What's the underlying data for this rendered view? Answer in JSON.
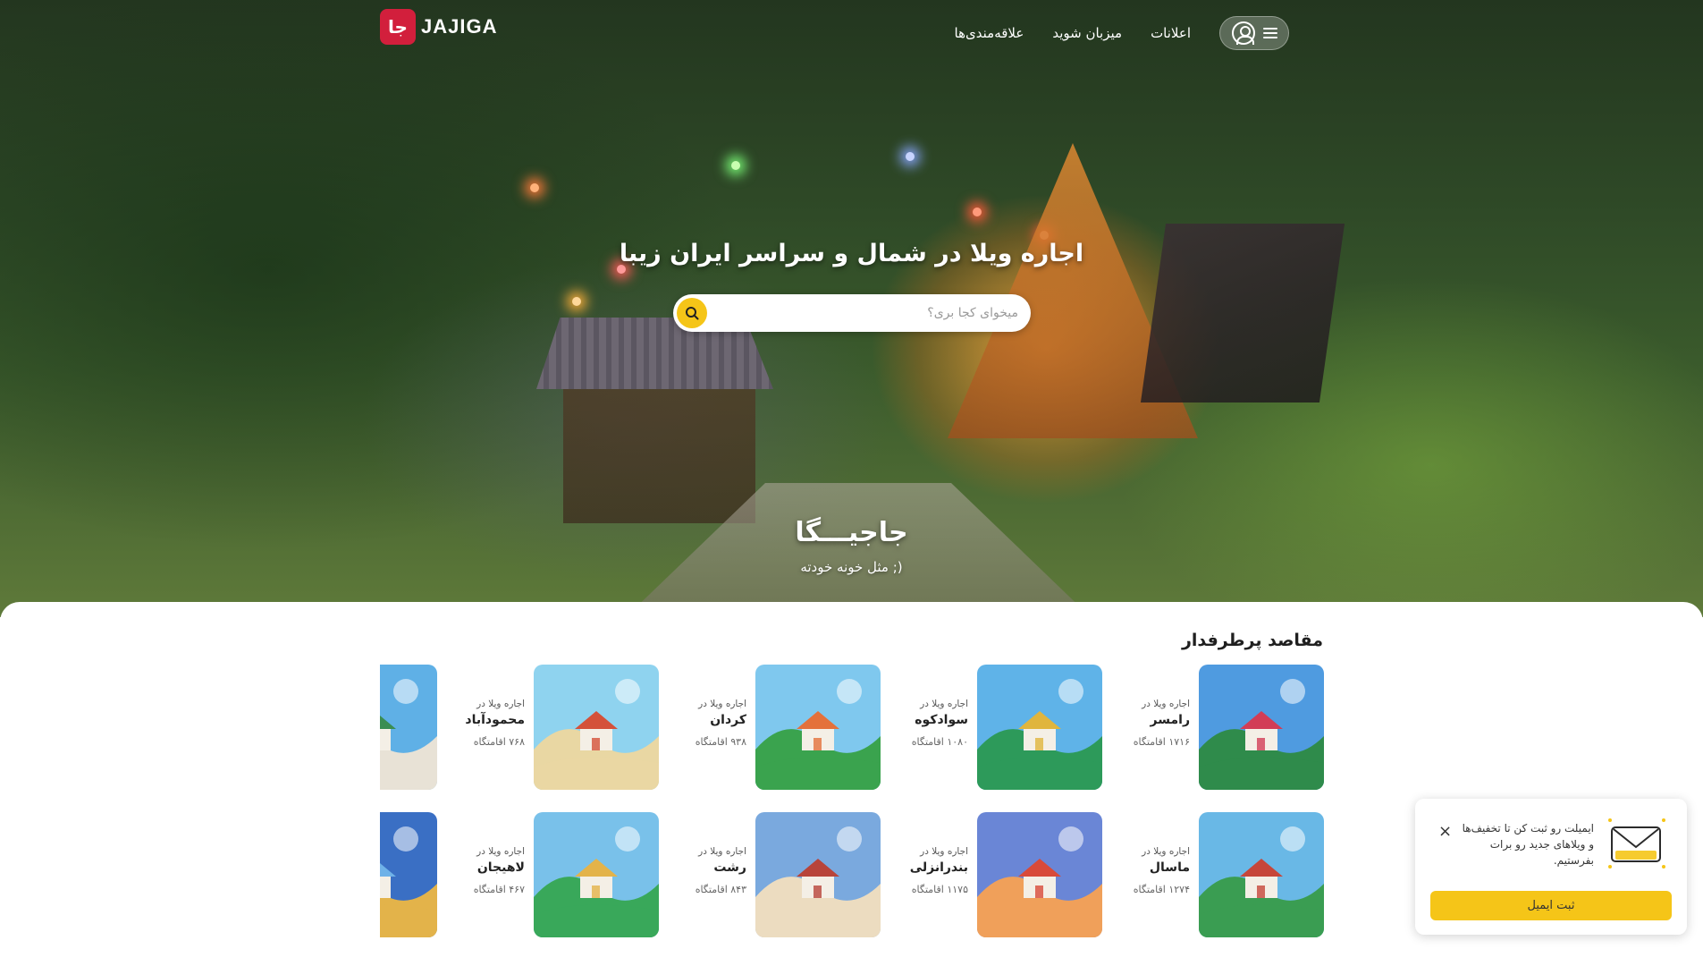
{
  "brand": {
    "logo_text": "JAJIGA",
    "logo_mark": "جا"
  },
  "nav": {
    "items": [
      {
        "label": "اعلانات"
      },
      {
        "label": "میزبان شوید"
      },
      {
        "label": "علاقه‌مندی‌ها"
      }
    ]
  },
  "hero": {
    "title": "اجاره ویلا در شمال و سراسر ایران زیبا",
    "search_placeholder": "میخوای کجا بری؟",
    "brand_name": "جاجیـــگا",
    "tagline": "مثل خونه خودته ;)"
  },
  "popular": {
    "title": "مقاصد پرطرفدار",
    "prefix": "اجاره ویلا در",
    "items": [
      {
        "name": "رامسر",
        "count": "۱۷۱۶ اقامتگاه",
        "colors": [
          "#4f9be0",
          "#2f8b4b",
          "#d23d56"
        ]
      },
      {
        "name": "سوادکوه",
        "count": "۱۰۸۰ اقامتگاه",
        "colors": [
          "#5fb3e8",
          "#2d9a5a",
          "#e0b53d"
        ]
      },
      {
        "name": "کردان",
        "count": "۹۳۸ اقامتگاه",
        "colors": [
          "#7fc8ee",
          "#3aa34e",
          "#e4713b"
        ]
      },
      {
        "name": "محمودآباد",
        "count": "۷۶۸ اقامتگاه",
        "colors": [
          "#8fd3ef",
          "#e9d7a3",
          "#d4513a"
        ]
      },
      {
        "name": "ماسال",
        "count": "۱۲۷۴ اقامتگاه",
        "colors": [
          "#69b8e6",
          "#3a9d52",
          "#c6463a"
        ]
      },
      {
        "name": "بندرانزلی",
        "count": "۱۱۷۵ اقامتگاه",
        "colors": [
          "#6a86d6",
          "#f0a05a",
          "#d84a3a"
        ]
      },
      {
        "name": "رشت",
        "count": "۸۴۳ اقامتگاه",
        "colors": [
          "#7aa9de",
          "#ecdcc0",
          "#b8443a"
        ]
      },
      {
        "name": "لاهیجان",
        "count": "۴۶۷ اقامتگاه",
        "colors": [
          "#79c1ea",
          "#39a85a",
          "#e3b34a"
        ]
      }
    ],
    "partial": [
      {
        "colors": [
          "#5fb0e6",
          "#e8e2d6",
          "#3a8d52"
        ]
      },
      {
        "colors": [
          "#3a6fc4",
          "#e3b34a",
          "#6fb2e8"
        ]
      }
    ]
  },
  "newsletter": {
    "text": "ایمیلت رو ثبت کن تا تخفیف‌ها و ویلاهای جدید رو برات بفرستیم.",
    "button_label": "ثبت ایمیل",
    "close_symbol": "×"
  }
}
